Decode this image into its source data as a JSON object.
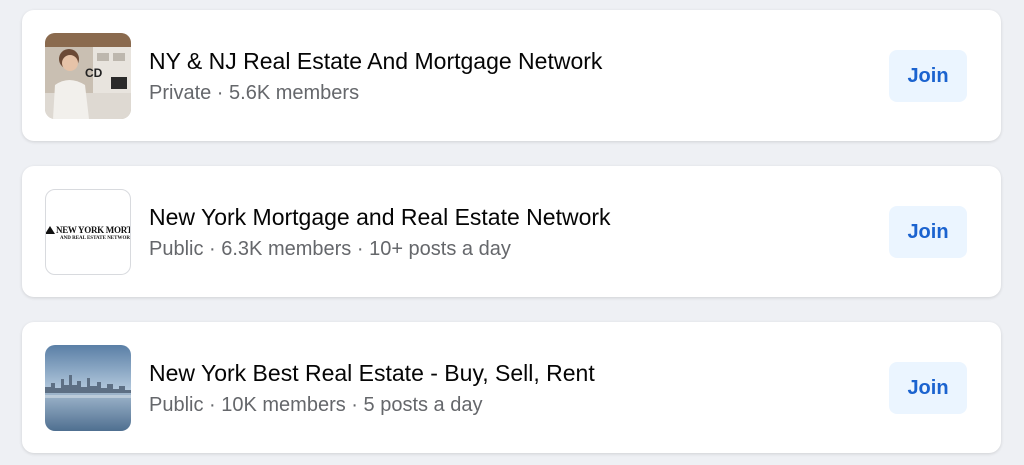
{
  "accent_color": "#1b63cf",
  "groups": [
    {
      "name": "NY & NJ Real Estate And Mortgage Network",
      "meta": "Private · 5.6K members",
      "join_label": "Join",
      "thumbnail": "woman-at-desk-photo"
    },
    {
      "name": "New York Mortgage and Real Estate Network",
      "meta": "Public · 6.3K members · 10+ posts a day",
      "join_label": "Join",
      "thumbnail": "logo",
      "logo_line1": "NEW YORK MORTGAGE",
      "logo_line2": "AND REAL ESTATE NETWORK"
    },
    {
      "name": "New York Best Real Estate - Buy, Sell, Rent",
      "meta": "Public · 10K members · 5 posts a day",
      "join_label": "Join",
      "thumbnail": "city-skyline-photo"
    }
  ]
}
